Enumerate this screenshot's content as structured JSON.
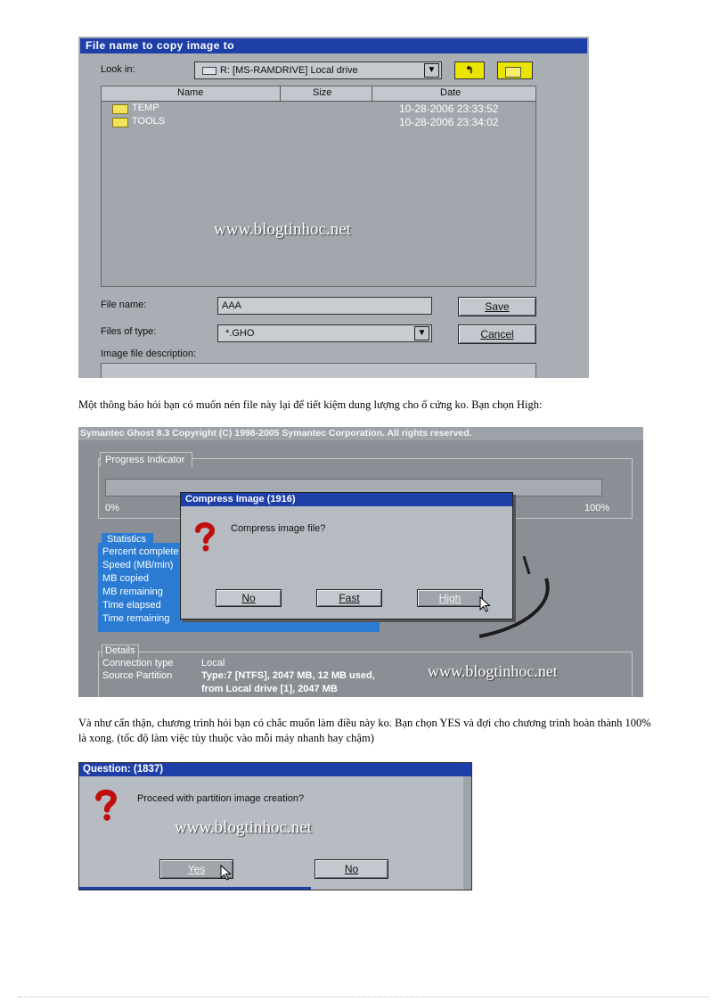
{
  "shot1": {
    "title": "File name to copy image to",
    "look_in_label": "Look in:",
    "look_in_value": "R: [MS-RAMDRIVE] Local drive",
    "columns": [
      "Name",
      "Size",
      "Date"
    ],
    "rows": [
      {
        "name": "TEMP",
        "date": "10-28-2006 23:33:52"
      },
      {
        "name": "TOOLS",
        "date": "10-28-2006 23:34:02"
      }
    ],
    "watermark": "www.blogtinhoc.net",
    "file_name_label": "File name:",
    "file_name_value": "AAA",
    "files_of_type_label": "Files of type:",
    "files_of_type_value": "*.GHO",
    "description_label": "Image file description:",
    "save_label": "Save",
    "cancel_label": "Cancel"
  },
  "para1": "Một thông báo hỏi bạn có muốn nén file này lại để tiết kiệm dung lượng cho ổ cứng ko. Bạn chọn High:",
  "shot2": {
    "titlebar": "Symantec Ghost 8.3   Copyright (C) 1998-2005 Symantec Corporation. All rights reserved.",
    "progress_label": "Progress Indicator",
    "pct_start": "0%",
    "pct_end": "100%",
    "stats_label": "Statistics",
    "stats": [
      "Percent complete",
      "Speed (MB/min)",
      "MB copied",
      "MB remaining",
      "Time elapsed",
      "Time remaining"
    ],
    "details_label": "Details",
    "conn_label": "Connection type",
    "conn_value": "Local",
    "src_label": "Source Partition",
    "src_value_1": "Type:7 [NTFS], 2047 MB, 12 MB used,",
    "src_value_2": "from Local drive [1], 2047 MB",
    "watermark": "www.blogtinhoc.net",
    "dialog_title": "Compress Image (1916)",
    "dialog_msg": "Compress image file?",
    "btn_no": "No",
    "btn_fast": "Fast",
    "btn_high": "High"
  },
  "para2_l1": "Và như cẩn thận, chương trình hỏi bạn có chắc muốn làm điều này ko. Bạn chọn YES  và đợi cho chương trình hoàn thành 100%",
  "para2_l2": "là xong. (tốc độ làm việc tùy thuộc vào mỗi máy nhanh hay chậm)",
  "shot3": {
    "title": "Question: (1837)",
    "msg": "Proceed with partition image creation?",
    "watermark": "www.blogtinhoc.net",
    "btn_yes": "Yes",
    "btn_no": "No"
  }
}
